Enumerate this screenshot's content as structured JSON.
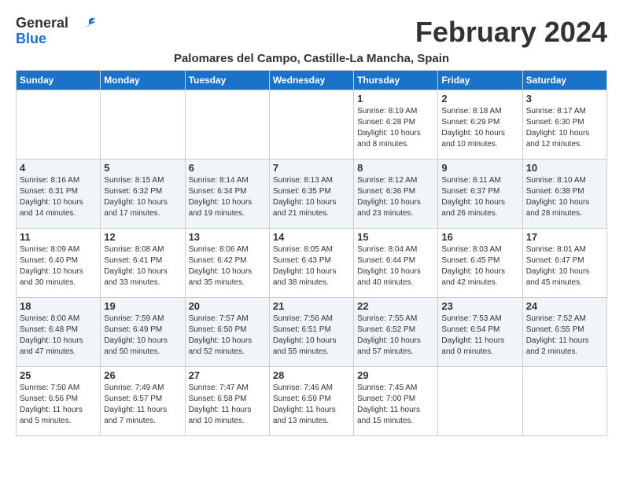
{
  "app": {
    "logo_general": "General",
    "logo_blue": "Blue",
    "month_title": "February 2024",
    "location": "Palomares del Campo, Castille-La Mancha, Spain"
  },
  "calendar": {
    "headers": [
      "Sunday",
      "Monday",
      "Tuesday",
      "Wednesday",
      "Thursday",
      "Friday",
      "Saturday"
    ],
    "weeks": [
      [
        {
          "day": "",
          "info": ""
        },
        {
          "day": "",
          "info": ""
        },
        {
          "day": "",
          "info": ""
        },
        {
          "day": "",
          "info": ""
        },
        {
          "day": "1",
          "info": "Sunrise: 8:19 AM\nSunset: 6:28 PM\nDaylight: 10 hours\nand 8 minutes."
        },
        {
          "day": "2",
          "info": "Sunrise: 8:18 AM\nSunset: 6:29 PM\nDaylight: 10 hours\nand 10 minutes."
        },
        {
          "day": "3",
          "info": "Sunrise: 8:17 AM\nSunset: 6:30 PM\nDaylight: 10 hours\nand 12 minutes."
        }
      ],
      [
        {
          "day": "4",
          "info": "Sunrise: 8:16 AM\nSunset: 6:31 PM\nDaylight: 10 hours\nand 14 minutes."
        },
        {
          "day": "5",
          "info": "Sunrise: 8:15 AM\nSunset: 6:32 PM\nDaylight: 10 hours\nand 17 minutes."
        },
        {
          "day": "6",
          "info": "Sunrise: 8:14 AM\nSunset: 6:34 PM\nDaylight: 10 hours\nand 19 minutes."
        },
        {
          "day": "7",
          "info": "Sunrise: 8:13 AM\nSunset: 6:35 PM\nDaylight: 10 hours\nand 21 minutes."
        },
        {
          "day": "8",
          "info": "Sunrise: 8:12 AM\nSunset: 6:36 PM\nDaylight: 10 hours\nand 23 minutes."
        },
        {
          "day": "9",
          "info": "Sunrise: 8:11 AM\nSunset: 6:37 PM\nDaylight: 10 hours\nand 26 minutes."
        },
        {
          "day": "10",
          "info": "Sunrise: 8:10 AM\nSunset: 6:38 PM\nDaylight: 10 hours\nand 28 minutes."
        }
      ],
      [
        {
          "day": "11",
          "info": "Sunrise: 8:09 AM\nSunset: 6:40 PM\nDaylight: 10 hours\nand 30 minutes."
        },
        {
          "day": "12",
          "info": "Sunrise: 8:08 AM\nSunset: 6:41 PM\nDaylight: 10 hours\nand 33 minutes."
        },
        {
          "day": "13",
          "info": "Sunrise: 8:06 AM\nSunset: 6:42 PM\nDaylight: 10 hours\nand 35 minutes."
        },
        {
          "day": "14",
          "info": "Sunrise: 8:05 AM\nSunset: 6:43 PM\nDaylight: 10 hours\nand 38 minutes."
        },
        {
          "day": "15",
          "info": "Sunrise: 8:04 AM\nSunset: 6:44 PM\nDaylight: 10 hours\nand 40 minutes."
        },
        {
          "day": "16",
          "info": "Sunrise: 8:03 AM\nSunset: 6:45 PM\nDaylight: 10 hours\nand 42 minutes."
        },
        {
          "day": "17",
          "info": "Sunrise: 8:01 AM\nSunset: 6:47 PM\nDaylight: 10 hours\nand 45 minutes."
        }
      ],
      [
        {
          "day": "18",
          "info": "Sunrise: 8:00 AM\nSunset: 6:48 PM\nDaylight: 10 hours\nand 47 minutes."
        },
        {
          "day": "19",
          "info": "Sunrise: 7:59 AM\nSunset: 6:49 PM\nDaylight: 10 hours\nand 50 minutes."
        },
        {
          "day": "20",
          "info": "Sunrise: 7:57 AM\nSunset: 6:50 PM\nDaylight: 10 hours\nand 52 minutes."
        },
        {
          "day": "21",
          "info": "Sunrise: 7:56 AM\nSunset: 6:51 PM\nDaylight: 10 hours\nand 55 minutes."
        },
        {
          "day": "22",
          "info": "Sunrise: 7:55 AM\nSunset: 6:52 PM\nDaylight: 10 hours\nand 57 minutes."
        },
        {
          "day": "23",
          "info": "Sunrise: 7:53 AM\nSunset: 6:54 PM\nDaylight: 11 hours\nand 0 minutes."
        },
        {
          "day": "24",
          "info": "Sunrise: 7:52 AM\nSunset: 6:55 PM\nDaylight: 11 hours\nand 2 minutes."
        }
      ],
      [
        {
          "day": "25",
          "info": "Sunrise: 7:50 AM\nSunset: 6:56 PM\nDaylight: 11 hours\nand 5 minutes."
        },
        {
          "day": "26",
          "info": "Sunrise: 7:49 AM\nSunset: 6:57 PM\nDaylight: 11 hours\nand 7 minutes."
        },
        {
          "day": "27",
          "info": "Sunrise: 7:47 AM\nSunset: 6:58 PM\nDaylight: 11 hours\nand 10 minutes."
        },
        {
          "day": "28",
          "info": "Sunrise: 7:46 AM\nSunset: 6:59 PM\nDaylight: 11 hours\nand 13 minutes."
        },
        {
          "day": "29",
          "info": "Sunrise: 7:45 AM\nSunset: 7:00 PM\nDaylight: 11 hours\nand 15 minutes."
        },
        {
          "day": "",
          "info": ""
        },
        {
          "day": "",
          "info": ""
        }
      ]
    ]
  }
}
